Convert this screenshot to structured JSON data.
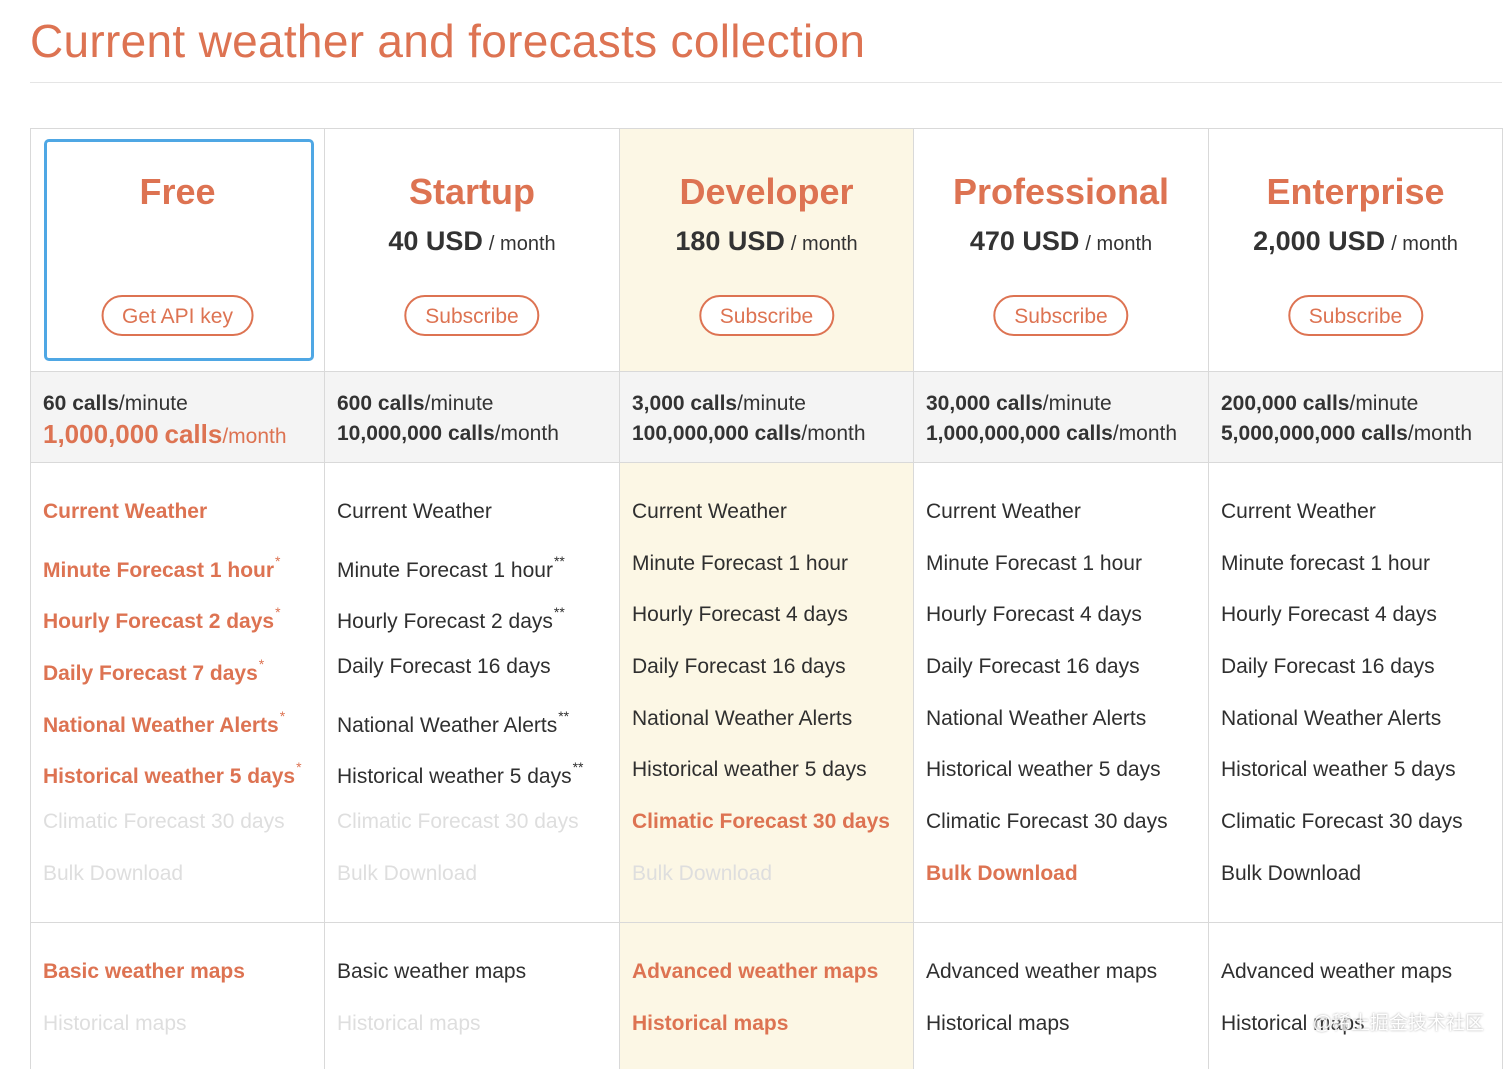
{
  "page_title": "Current weather and forecasts collection",
  "colors": {
    "accent": "#dd7352",
    "selected_border": "#4fa7e4",
    "highlight_bg": "#fcf7e5",
    "disabled_text": "#dedede"
  },
  "watermark": "@稀土掘金技术社区",
  "plans": [
    {
      "name": "Free",
      "price": "",
      "unit": "",
      "button": "Get API key",
      "selected": true,
      "highlight": false,
      "calls_minute_num": "60",
      "calls_word": "calls",
      "calls_minute_unit": "/minute",
      "calls_month_num": "1,000,000",
      "calls_month_unit": "/month",
      "month_emphasis": true,
      "features": [
        {
          "label": "Current Weather",
          "mark": "",
          "state": "incl"
        },
        {
          "label": "Minute Forecast 1 hour",
          "mark": "*",
          "state": "incl"
        },
        {
          "label": "Hourly Forecast 2 days",
          "mark": "*",
          "state": "incl"
        },
        {
          "label": "Daily Forecast 7 days",
          "mark": "*",
          "state": "incl"
        },
        {
          "label": "National Weather Alerts",
          "mark": "*",
          "state": "incl"
        },
        {
          "label": "Historical weather 5 days",
          "mark": "*",
          "state": "incl"
        },
        {
          "label": "Climatic Forecast 30 days",
          "mark": "",
          "state": "excl"
        },
        {
          "label": "Bulk Download",
          "mark": "",
          "state": "excl"
        }
      ],
      "maps": [
        {
          "label": "Basic weather maps",
          "mark": "",
          "state": "incl"
        },
        {
          "label": "Historical maps",
          "mark": "",
          "state": "excl"
        }
      ]
    },
    {
      "name": "Startup",
      "price": "40 USD",
      "unit": "/ month",
      "button": "Subscribe",
      "selected": false,
      "highlight": false,
      "calls_minute_num": "600",
      "calls_word": "calls",
      "calls_minute_unit": "/minute",
      "calls_month_num": "10,000,000",
      "calls_month_unit": "/month",
      "month_emphasis": false,
      "features": [
        {
          "label": "Current Weather",
          "mark": "",
          "state": "norm"
        },
        {
          "label": "Minute Forecast 1 hour",
          "mark": "**",
          "state": "norm"
        },
        {
          "label": "Hourly Forecast 2 days",
          "mark": "**",
          "state": "norm"
        },
        {
          "label": "Daily Forecast 16 days",
          "mark": "",
          "state": "norm"
        },
        {
          "label": "National Weather Alerts",
          "mark": "**",
          "state": "norm"
        },
        {
          "label": "Historical weather 5 days",
          "mark": "**",
          "state": "norm"
        },
        {
          "label": "Climatic Forecast 30 days",
          "mark": "",
          "state": "excl"
        },
        {
          "label": "Bulk Download",
          "mark": "",
          "state": "excl"
        }
      ],
      "maps": [
        {
          "label": "Basic weather maps",
          "mark": "",
          "state": "norm"
        },
        {
          "label": "Historical maps",
          "mark": "",
          "state": "excl"
        }
      ]
    },
    {
      "name": "Developer",
      "price": "180 USD",
      "unit": "/ month",
      "button": "Subscribe",
      "selected": false,
      "highlight": true,
      "calls_minute_num": "3,000",
      "calls_word": "calls",
      "calls_minute_unit": "/minute",
      "calls_month_num": "100,000,000",
      "calls_month_unit": "/month",
      "month_emphasis": false,
      "features": [
        {
          "label": "Current Weather",
          "mark": "",
          "state": "norm"
        },
        {
          "label": "Minute Forecast 1 hour",
          "mark": "",
          "state": "norm"
        },
        {
          "label": "Hourly Forecast 4 days",
          "mark": "",
          "state": "norm"
        },
        {
          "label": "Daily Forecast 16 days",
          "mark": "",
          "state": "norm"
        },
        {
          "label": "National Weather Alerts",
          "mark": "",
          "state": "norm"
        },
        {
          "label": "Historical weather 5 days",
          "mark": "",
          "state": "norm"
        },
        {
          "label": "Climatic Forecast 30 days",
          "mark": "",
          "state": "incl"
        },
        {
          "label": "Bulk Download",
          "mark": "",
          "state": "excl"
        }
      ],
      "maps": [
        {
          "label": "Advanced weather maps",
          "mark": "",
          "state": "incl"
        },
        {
          "label": "Historical maps",
          "mark": "",
          "state": "incl"
        }
      ]
    },
    {
      "name": "Professional",
      "price": "470 USD",
      "unit": "/ month",
      "button": "Subscribe",
      "selected": false,
      "highlight": false,
      "calls_minute_num": "30,000",
      "calls_word": "calls",
      "calls_minute_unit": "/minute",
      "calls_month_num": "1,000,000,000",
      "calls_month_unit": "/month",
      "month_emphasis": false,
      "features": [
        {
          "label": "Current Weather",
          "mark": "",
          "state": "norm"
        },
        {
          "label": "Minute Forecast 1 hour",
          "mark": "",
          "state": "norm"
        },
        {
          "label": "Hourly Forecast 4 days",
          "mark": "",
          "state": "norm"
        },
        {
          "label": "Daily Forecast 16 days",
          "mark": "",
          "state": "norm"
        },
        {
          "label": "National Weather Alerts",
          "mark": "",
          "state": "norm"
        },
        {
          "label": "Historical weather 5 days",
          "mark": "",
          "state": "norm"
        },
        {
          "label": "Climatic Forecast 30 days",
          "mark": "",
          "state": "norm"
        },
        {
          "label": "Bulk Download",
          "mark": "",
          "state": "incl"
        }
      ],
      "maps": [
        {
          "label": "Advanced weather maps",
          "mark": "",
          "state": "norm"
        },
        {
          "label": "Historical maps",
          "mark": "",
          "state": "norm"
        }
      ]
    },
    {
      "name": "Enterprise",
      "price": "2,000 USD",
      "unit": "/ month",
      "button": "Subscribe",
      "selected": false,
      "highlight": false,
      "calls_minute_num": "200,000",
      "calls_word": "calls",
      "calls_minute_unit": "/minute",
      "calls_month_num": "5,000,000,000",
      "calls_month_unit": "/month",
      "month_emphasis": false,
      "features": [
        {
          "label": "Current Weather",
          "mark": "",
          "state": "norm"
        },
        {
          "label": "Minute forecast 1 hour",
          "mark": "",
          "state": "norm"
        },
        {
          "label": "Hourly Forecast 4 days",
          "mark": "",
          "state": "norm"
        },
        {
          "label": "Daily Forecast 16 days",
          "mark": "",
          "state": "norm"
        },
        {
          "label": "National Weather Alerts",
          "mark": "",
          "state": "norm"
        },
        {
          "label": "Historical weather 5 days",
          "mark": "",
          "state": "norm"
        },
        {
          "label": "Climatic Forecast 30 days",
          "mark": "",
          "state": "norm"
        },
        {
          "label": "Bulk Download",
          "mark": "",
          "state": "norm"
        }
      ],
      "maps": [
        {
          "label": "Advanced weather maps",
          "mark": "",
          "state": "norm"
        },
        {
          "label": "Historical maps",
          "mark": "",
          "state": "norm"
        }
      ]
    }
  ]
}
